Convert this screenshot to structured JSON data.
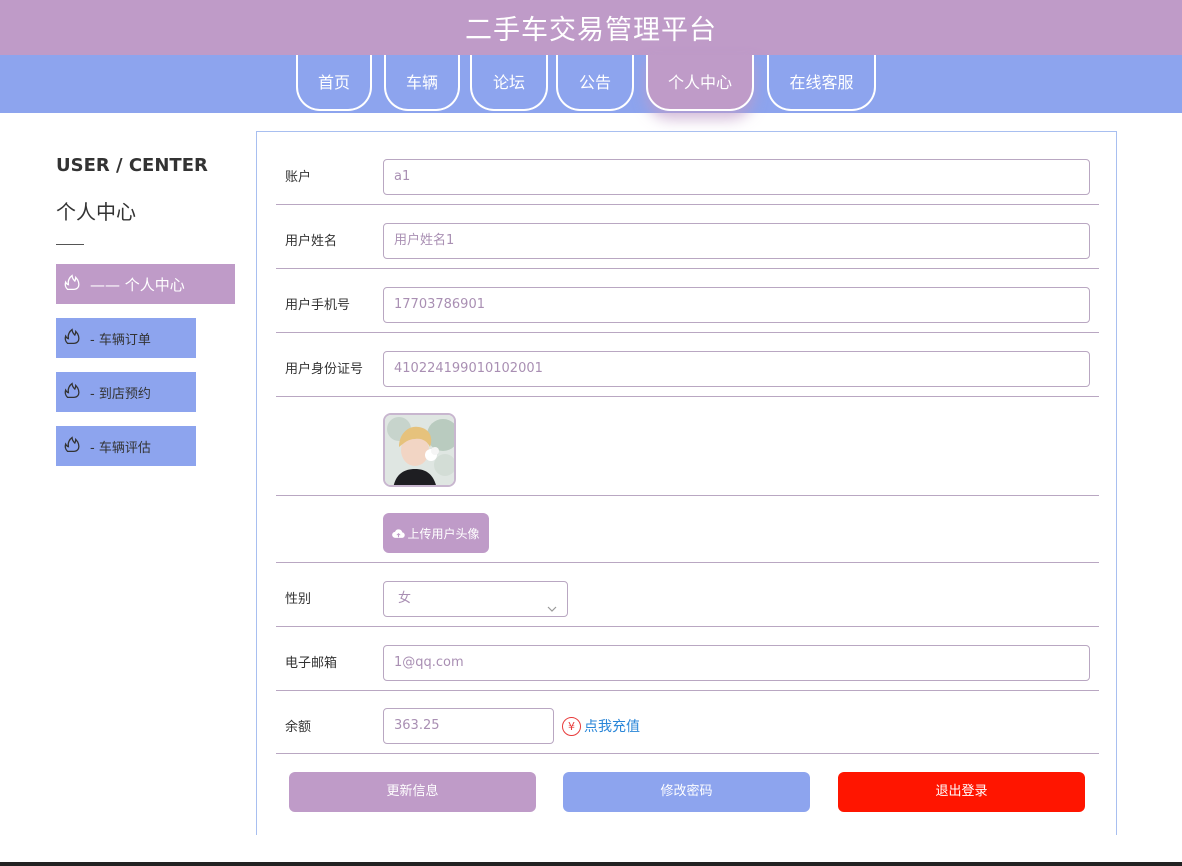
{
  "header": {
    "title": "二手车交易管理平台"
  },
  "nav": {
    "items": [
      {
        "label": "首页"
      },
      {
        "label": "车辆"
      },
      {
        "label": "论坛"
      },
      {
        "label": "公告"
      },
      {
        "label": "个人中心"
      },
      {
        "label": "在线客服"
      }
    ],
    "active": "个人中心"
  },
  "sidebar": {
    "title_en": "USER / CENTER",
    "title_cn": "个人中心",
    "items": [
      {
        "label": "—— 个人中心"
      },
      {
        "label": "- 车辆订单"
      },
      {
        "label": "- 到店预约"
      },
      {
        "label": "- 车辆评估"
      }
    ]
  },
  "form": {
    "account": {
      "label": "账户",
      "value": "a1"
    },
    "name": {
      "label": "用户姓名",
      "value": "用户姓名1"
    },
    "phone": {
      "label": "用户手机号",
      "value": "17703786901"
    },
    "idcard": {
      "label": "用户身份证号",
      "value": "410224199010102001"
    },
    "upload_label": "上传用户头像",
    "gender": {
      "label": "性别",
      "value": "女"
    },
    "email": {
      "label": "电子邮箱",
      "value": "1@qq.com"
    },
    "balance": {
      "label": "余额",
      "value": "363.25",
      "recharge_label": "点我充值"
    }
  },
  "actions": {
    "update": "更新信息",
    "password": "修改密码",
    "logout": "退出登录"
  },
  "colors": {
    "primary": "#bf9bc8",
    "secondary": "#8da4ee",
    "danger": "#ff1500",
    "link": "#2a86d8"
  },
  "icons": {
    "sidebar": "flame-icon",
    "upload": "cloud-upload-icon",
    "select": "chevron-down-icon",
    "currency": "yen-icon"
  }
}
